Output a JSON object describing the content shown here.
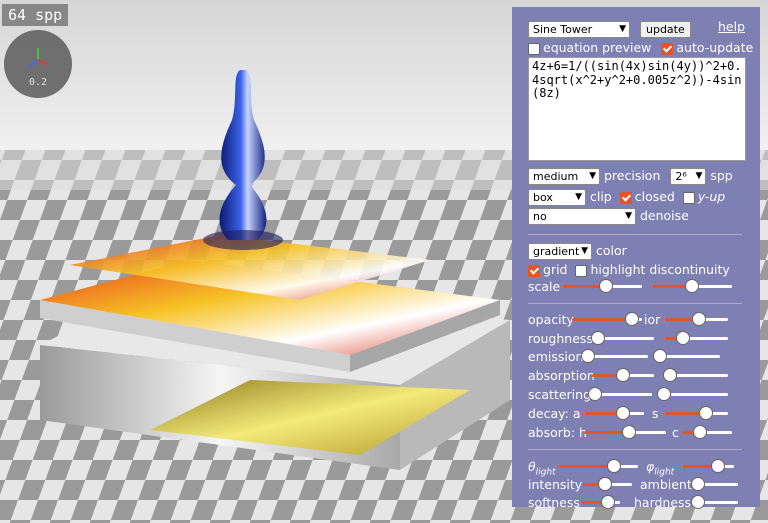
{
  "overlay": {
    "spp_counter": "64 spp",
    "axes_scale": "0.2"
  },
  "panel": {
    "preset": "Sine Tower",
    "update_label": "update",
    "help_label": "help",
    "equation_preview_label": "equation preview",
    "equation_preview_checked": false,
    "auto_update_label": "auto-update",
    "auto_update_checked": true,
    "equation": "4z+6=1/((sin(4x)sin(4y))^2+0.4sqrt(x^2+y^2+0.005z^2))-4sin(8z)",
    "precision_value": "medium",
    "precision_label": "precision",
    "spp_value": "2⁶",
    "spp_label": "spp",
    "clip_value": "box",
    "clip_label": "clip",
    "closed_label": "closed",
    "closed_checked": true,
    "y_up_label": "y-up",
    "y_up_checked": false,
    "denoise_value": "no",
    "denoise_label": "denoise",
    "color_value": "gradient",
    "color_label": "color",
    "grid_label": "grid",
    "grid_checked": true,
    "highlight_label": "highlight discontinuity",
    "highlight_checked": false,
    "scale_label": "scale",
    "opacity_label": "opacity",
    "ior_label": "ior",
    "roughness_label": "roughness",
    "emission_label": "emission",
    "absorption_label": "absorption",
    "scattering_label": "scattering",
    "decay_label": "decay: a",
    "s_label": "s",
    "absorb_label": "absorb: h",
    "c_label": "c",
    "theta_label": "θ",
    "theta_sub": "light",
    "phi_label": "φ",
    "phi_sub": "light",
    "intensity_label": "intensity",
    "ambient_label": "ambient",
    "softness_label": "softness",
    "hardness_label": "hardness"
  },
  "sliders": {
    "scale_a": 0.55,
    "scale_b": 0.5,
    "opacity": 0.85,
    "ior": 0.55,
    "roughness": 0.1,
    "roughness_b": 0.3,
    "emission": 0.0,
    "emission_b": 0.0,
    "absorption": 0.5,
    "absorption_b": 0.1,
    "scattering": 0.05,
    "scattering_b": 0.0,
    "decay_a": 0.65,
    "decay_s": 0.65,
    "absorb_h": 0.55,
    "absorb_c": 0.35,
    "theta": 0.7,
    "phi": 0.7,
    "intensity": 0.45,
    "ambient": 0.0,
    "softness": 0.7,
    "hardness": 0.0
  },
  "colors": {
    "panel_bg": "#7e7fb2",
    "accent": "#e0552b"
  }
}
